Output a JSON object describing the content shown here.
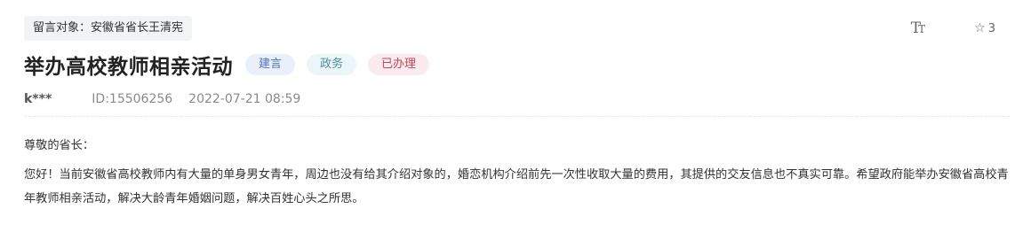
{
  "recipient": {
    "label": "留言对象：安徽省省长王清宪"
  },
  "toolbar": {
    "font_size_icon": "font-size-icon",
    "favorite_icon": "star-outline-icon",
    "favorite_count": "3"
  },
  "message": {
    "title": "举办高校教师相亲活动",
    "tags": {
      "type": "建言",
      "domain": "政务",
      "status": "已办理"
    },
    "author": "k***",
    "id": "ID:15506256",
    "datetime": "2022-07-21 08:59",
    "salutation": "尊敬的省长：",
    "body": "您好！当前安徽省高校教师内有大量的单身男女青年，周边也没有给其介绍对象的，婚恋机构介绍前先一次性收取大量的费用，其提供的交友信息也不真实可靠。希望政府能举办安徽省高校青年教师相亲活动，解决大龄青年婚姻问题，解决百姓心头之所思。"
  },
  "colors": {
    "status_red": "#c54655",
    "type_blue": "#4a74b8",
    "domain_teal": "#4a8ea0"
  }
}
